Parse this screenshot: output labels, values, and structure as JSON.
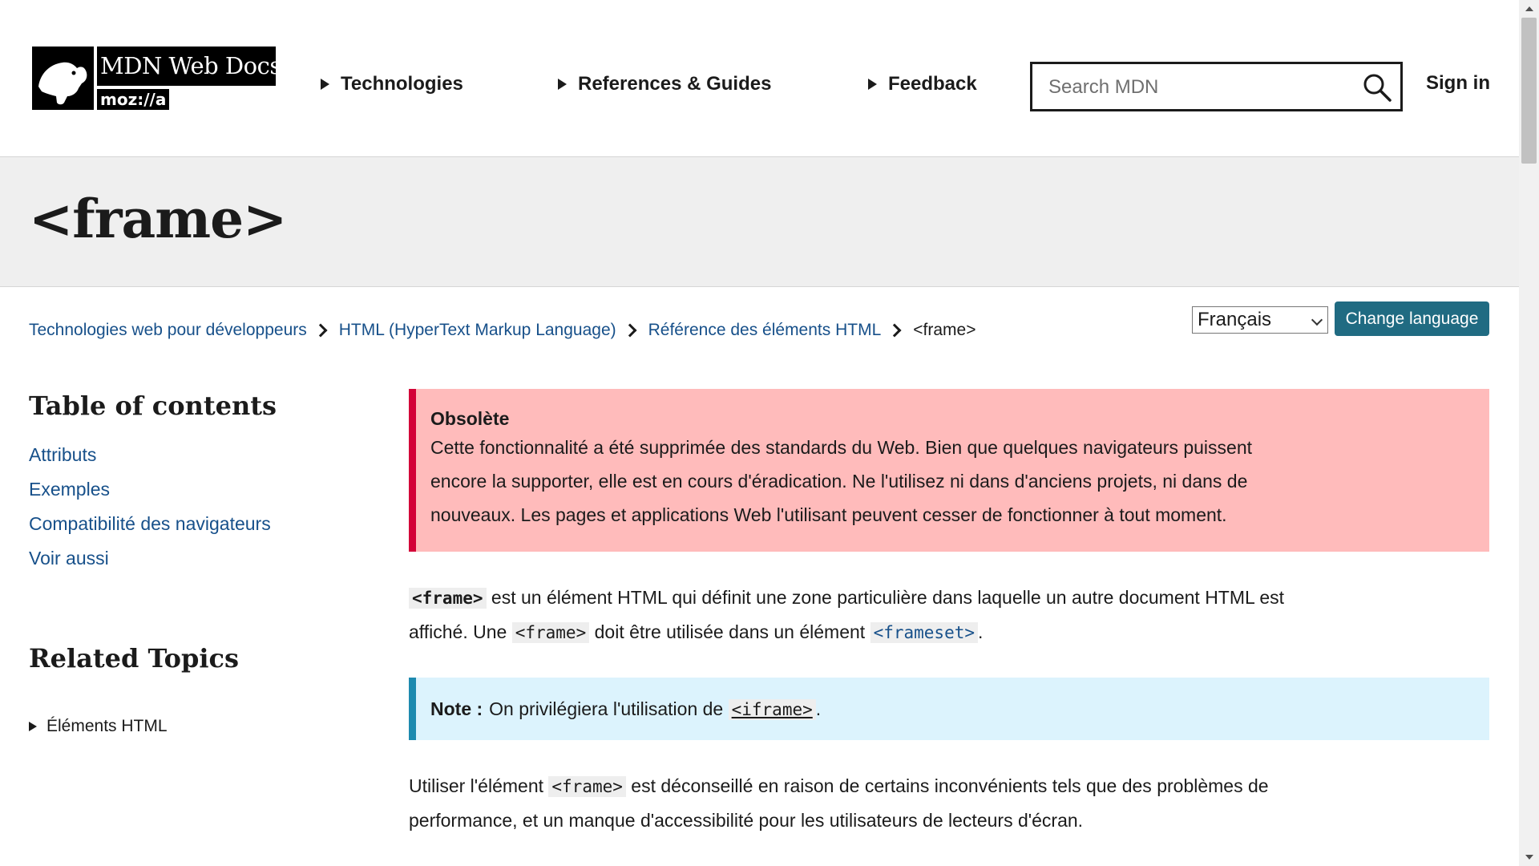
{
  "header": {
    "logo_title": "MDN Web Docs",
    "logo_moz": "moz://a",
    "nav": [
      "Technologies",
      "References & Guides",
      "Feedback"
    ],
    "search_placeholder": "Search MDN",
    "sign_in": "Sign in"
  },
  "page": {
    "title": "<frame>"
  },
  "breadcrumbs": [
    "Technologies web pour développeurs",
    "HTML (HyperText Markup Language)",
    "Référence des éléments HTML",
    "<frame>"
  ],
  "language": {
    "selected": "Français",
    "button": "Change language"
  },
  "sidebar": {
    "toc_heading": "Table of contents",
    "toc": [
      "Attributs",
      "Exemples",
      "Compatibilité des navigateurs",
      "Voir aussi"
    ],
    "related_heading": "Related Topics",
    "related_item": "Éléments HTML"
  },
  "content": {
    "obsolete_title": "Obsolète",
    "obsolete_body": "Cette fonctionnalité a été supprimée des standards du Web. Bien que quelques navigateurs puissent encore la supporter, elle est en cours d'éradication. Ne l'utilisez ni dans d'anciens projets, ni dans de nouveaux. Les pages et applications Web l'utilisant peuvent cesser de fonctionner à tout moment.",
    "intro": {
      "code1": "<frame>",
      "text1": " est un élément HTML qui définit une zone particulière dans laquelle un autre document HTML est affiché. Une ",
      "code2": "<frame>",
      "text2": " doit être utilisée dans un élément ",
      "code3": "<frameset>",
      "text3": "."
    },
    "note": {
      "label": "Note :",
      "text": "On privilégiera l'utilisation de",
      "code": "<iframe>",
      "end": "."
    },
    "para2": {
      "text1": "Utiliser l'élément ",
      "code": "<frame>",
      "text2": " est déconseillé en raison de certains inconvénients tels que des problèmes de performance, et un manque d'accessibilité pour les utilisateurs de lecteurs d'écran."
    }
  },
  "colors": {
    "link": "#17508a",
    "obsolete_bg": "#ffbbbb",
    "obsolete_border": "#d30038",
    "note_bg": "#dcf3fd",
    "note_border": "#1d8aaf",
    "button_bg": "#206b82",
    "title_band_bg": "#efefef"
  },
  "icons": {
    "search": "search-icon",
    "logo": "dinosaur-logo-icon"
  }
}
